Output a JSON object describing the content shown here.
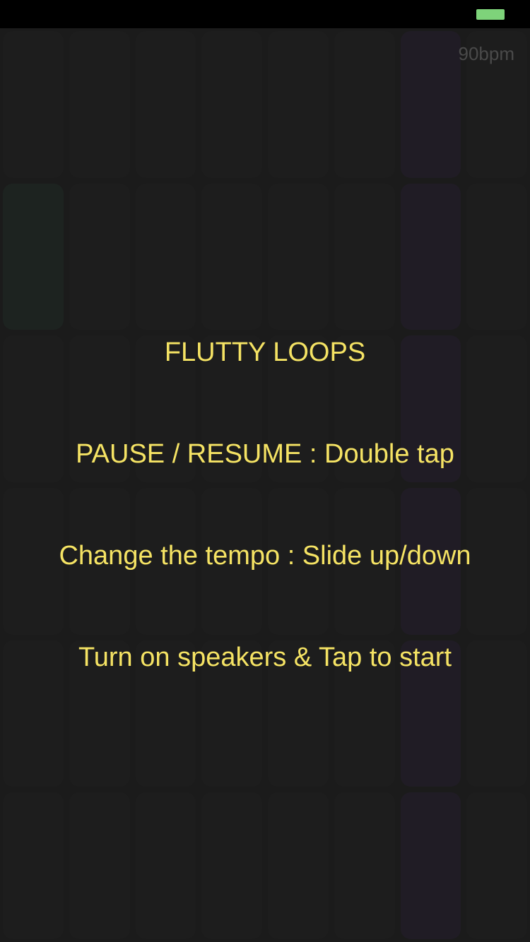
{
  "status_bar": {
    "battery_color": "#7ed37a"
  },
  "tempo": {
    "label": "90bpm",
    "color": "#4a4a4a"
  },
  "grid": {
    "columns": 8,
    "rows": 6,
    "active_cells": [
      {
        "col": 0,
        "row": 1,
        "color": "#1d2320"
      },
      {
        "col": 6,
        "row": 0,
        "color": "#201c25"
      },
      {
        "col": 6,
        "row": 1,
        "color": "#201c25"
      },
      {
        "col": 6,
        "row": 2,
        "color": "#201c25"
      },
      {
        "col": 6,
        "row": 3,
        "color": "#201c25"
      },
      {
        "col": 6,
        "row": 4,
        "color": "#201c25"
      },
      {
        "col": 6,
        "row": 5,
        "color": "#201c25"
      }
    ],
    "idle_color": "#1d1d1d"
  },
  "instructions": {
    "color": "#f5e364",
    "title": "FLUTTY LOOPS",
    "pause_resume": "PAUSE / RESUME : Double tap",
    "tempo_change": "Change the tempo : Slide up/down",
    "start": "Turn on speakers & Tap to start"
  }
}
